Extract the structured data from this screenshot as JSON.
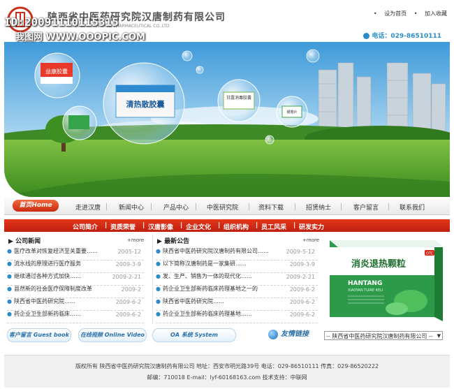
{
  "watermark": {
    "id_text": "ID:20091110115315",
    "site_text": "我图网 WWW.OOOPIC.COM"
  },
  "header": {
    "company_name": "陕西省中医药研究院汉唐制药有限公司",
    "company_en": "SHAANXI HAN TANG PHARMACEUTICAL CO.,LTD",
    "toplinks": [
      "设为首页",
      "加入收藏"
    ],
    "phone_label": "电话：029-86510111"
  },
  "banner": {
    "bubbles": [
      "益康胶囊",
      "清热散胶囊",
      "甘露消毒胶囊",
      "银翘片"
    ]
  },
  "nav": {
    "home": "首页Home",
    "items": [
      "走进汉唐",
      "新闻中心",
      "产品中心",
      "中医研究院",
      "资料下载",
      "招贤纳士",
      "客户留言",
      "联系我们"
    ]
  },
  "subnav": [
    "公司简介",
    "资质荣誉",
    "汉唐影像",
    "企业文化",
    "组织机构",
    "员工风采",
    "研发实力"
  ],
  "company_news": {
    "title": "公司新闻",
    "more": "more",
    "items": [
      {
        "text": "医疗改革对恢复经济至关重要……",
        "date": "2005-12"
      },
      {
        "text": "流水线的原理进行医疗服务",
        "date": "2009-3-9"
      },
      {
        "text": "继续通过各种方式加快……",
        "date": "2009-2-21"
      },
      {
        "text": "县然新的社会医疗保障制度改革",
        "date": "2009-2"
      },
      {
        "text": "陕西省中医药研究院……",
        "date": "2009-6-2"
      },
      {
        "text": "药企业卫生部新药临床……",
        "date": "2009-6-2"
      }
    ]
  },
  "notice": {
    "title": "最新公告",
    "more": "more",
    "items": [
      {
        "text": "陕西省中医药研究院汉唐制药有限公司……",
        "date": "2009-5-12"
      },
      {
        "text": "以下简称汉唐制药是一家集研……",
        "date": "2009-3-9"
      },
      {
        "text": "发、生产、销售为一体的现代化……",
        "date": "2009-2-21"
      },
      {
        "text": "药企业卫生部新药临床药理基地之一的",
        "date": "2009-6-2"
      },
      {
        "text": "陕西省中医药研究院……",
        "date": "2009-6-2"
      },
      {
        "text": "药企业卫生部新药临床药理基地……",
        "date": "2009-6-2"
      }
    ]
  },
  "product": {
    "name": "消炎退热颗粒",
    "brand": "HANTANG",
    "sub": "XIAOYAN TUIRE KELI",
    "tag": "OTC"
  },
  "bottom_buttons": [
    "客户留言 Guest book",
    "在线视频 Online Video",
    "OA 系统 System"
  ],
  "friend_link": {
    "label": "友情链接",
    "selected": "-- 陕西省中医药研究院汉唐制药有限公司 --"
  },
  "footer": {
    "line1": "版权所有 陕西省中医药研究院汉唐制药有限公司  地址：西安市明光路39号  电话：029-86510111  传真：029-86520222",
    "line2": "邮编：710018  E-mail：lyf-60168163.com  技术支持：中联网"
  },
  "colors": {
    "accent_red": "#d42a12",
    "accent_blue": "#2a8dc7"
  }
}
